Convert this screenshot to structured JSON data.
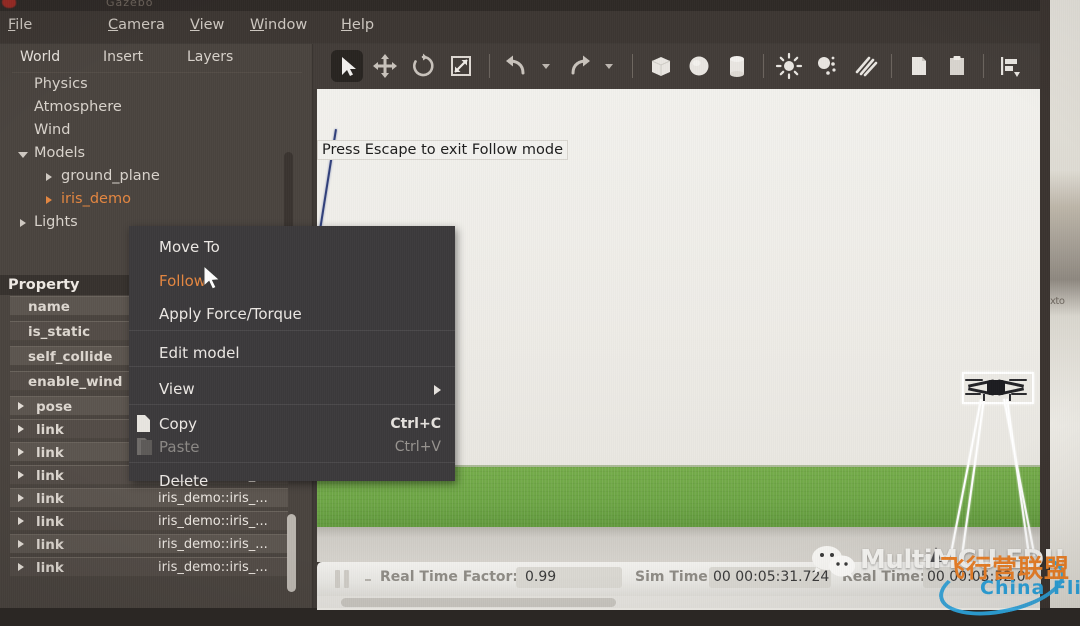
{
  "window": {
    "title_ghost": "Gazebo"
  },
  "menubar": {
    "items": [
      {
        "label": "File",
        "mnemonic": "F"
      },
      {
        "label": "Camera",
        "mnemonic": "C"
      },
      {
        "label": "View",
        "mnemonic": "V"
      },
      {
        "label": "Window",
        "mnemonic": "W"
      },
      {
        "label": "Help",
        "mnemonic": "H"
      }
    ]
  },
  "left_panel": {
    "tabs": [
      {
        "label": "World",
        "active": true
      },
      {
        "label": "Insert",
        "active": false
      },
      {
        "label": "Layers",
        "active": false
      }
    ],
    "tree": [
      {
        "label": "Physics",
        "indent": 0,
        "caret": "none",
        "selected": false
      },
      {
        "label": "Atmosphere",
        "indent": 0,
        "caret": "none",
        "selected": false
      },
      {
        "label": "Wind",
        "indent": 0,
        "caret": "none",
        "selected": false
      },
      {
        "label": "Models",
        "indent": 0,
        "caret": "open",
        "selected": false
      },
      {
        "label": "ground_plane",
        "indent": 1,
        "caret": "closed",
        "selected": false
      },
      {
        "label": "iris_demo",
        "indent": 1,
        "caret": "closed",
        "selected": true
      },
      {
        "label": "Lights",
        "indent": 0,
        "caret": "closed",
        "selected": false
      }
    ],
    "property_header": "Property",
    "properties": [
      {
        "name": "name",
        "value": "",
        "caret": false
      },
      {
        "name": "is_static",
        "value": "",
        "caret": false
      },
      {
        "name": "self_collide",
        "value": "",
        "caret": false
      },
      {
        "name": "enable_wind",
        "value": "",
        "caret": false
      },
      {
        "name": "pose",
        "value": "",
        "caret": true
      },
      {
        "name": "link",
        "value": "",
        "caret": true
      },
      {
        "name": "link",
        "value": "",
        "caret": true
      },
      {
        "name": "link",
        "value": "iris_demo::iris_...",
        "caret": true
      },
      {
        "name": "link",
        "value": "iris_demo::iris_...",
        "caret": true
      },
      {
        "name": "link",
        "value": "iris_demo::iris_...",
        "caret": true
      },
      {
        "name": "link",
        "value": "iris_demo::iris_...",
        "caret": true
      },
      {
        "name": "link",
        "value": "iris_demo::iris_...",
        "caret": true
      }
    ]
  },
  "toolbar": {
    "buttons": [
      {
        "icon": "select-arrow-icon",
        "active": true
      },
      {
        "icon": "translate-icon",
        "active": false
      },
      {
        "icon": "rotate-icon",
        "active": false
      },
      {
        "icon": "scale-icon",
        "active": false
      },
      {
        "icon": "undo-icon",
        "active": false
      },
      {
        "icon": "redo-icon",
        "active": false
      },
      {
        "icon": "box-icon",
        "active": false
      },
      {
        "icon": "sphere-icon",
        "active": false
      },
      {
        "icon": "cylinder-icon",
        "active": false
      },
      {
        "icon": "point-light-icon",
        "active": false
      },
      {
        "icon": "spot-light-icon",
        "active": false
      },
      {
        "icon": "directional-light-icon",
        "active": false
      },
      {
        "icon": "copy-icon",
        "active": false
      },
      {
        "icon": "paste-icon",
        "active": false
      },
      {
        "icon": "align-icon",
        "active": false
      }
    ]
  },
  "viewport": {
    "tooltip": "Press Escape to exit Follow mode",
    "selected_model": "iris_demo"
  },
  "context_menu": {
    "items": [
      {
        "label": "Move To",
        "shortcut": "",
        "highlight": false,
        "disabled": false,
        "submenu": false,
        "icon": ""
      },
      {
        "label": "Follow",
        "shortcut": "",
        "highlight": true,
        "disabled": false,
        "submenu": false,
        "icon": ""
      },
      {
        "label": "Apply Force/Torque",
        "shortcut": "",
        "highlight": false,
        "disabled": false,
        "submenu": false,
        "icon": ""
      },
      {
        "label": "Edit model",
        "shortcut": "",
        "highlight": false,
        "disabled": false,
        "submenu": false,
        "icon": ""
      },
      {
        "label": "View",
        "shortcut": "",
        "highlight": false,
        "disabled": false,
        "submenu": true,
        "icon": ""
      },
      {
        "label": "Copy",
        "shortcut": "Ctrl+C",
        "highlight": false,
        "disabled": false,
        "submenu": false,
        "icon": "copy-icon"
      },
      {
        "label": "Paste",
        "shortcut": "Ctrl+V",
        "highlight": false,
        "disabled": true,
        "submenu": false,
        "icon": "paste-icon"
      },
      {
        "label": "Delete",
        "shortcut": "",
        "highlight": false,
        "disabled": false,
        "submenu": false,
        "icon": ""
      }
    ]
  },
  "statusbar": {
    "pause_icon": "pause-icon",
    "real_time_factor_label": "Real Time Factor:",
    "real_time_factor_value": "0.99",
    "sim_time_label": "Sim Time:",
    "sim_time_value": "00 00:05:31.724",
    "real_time_label": "Real Time:",
    "real_time_value": "00 00:05:52.0"
  },
  "watermark": {
    "brand": "MultiMCU EDU",
    "chinese": "飞行营联盟",
    "english": "China Flier"
  },
  "background_window": {
    "edge_text": "xto",
    "star_icon": "star-icon"
  },
  "colors": {
    "accent_orange": "#e8853c",
    "panel_bg": "#4a443f",
    "menu_bg": "#3d3733",
    "ground_green": "#6aa640",
    "watermark_blue": "#27a3df",
    "watermark_orange": "#ef7f22"
  }
}
